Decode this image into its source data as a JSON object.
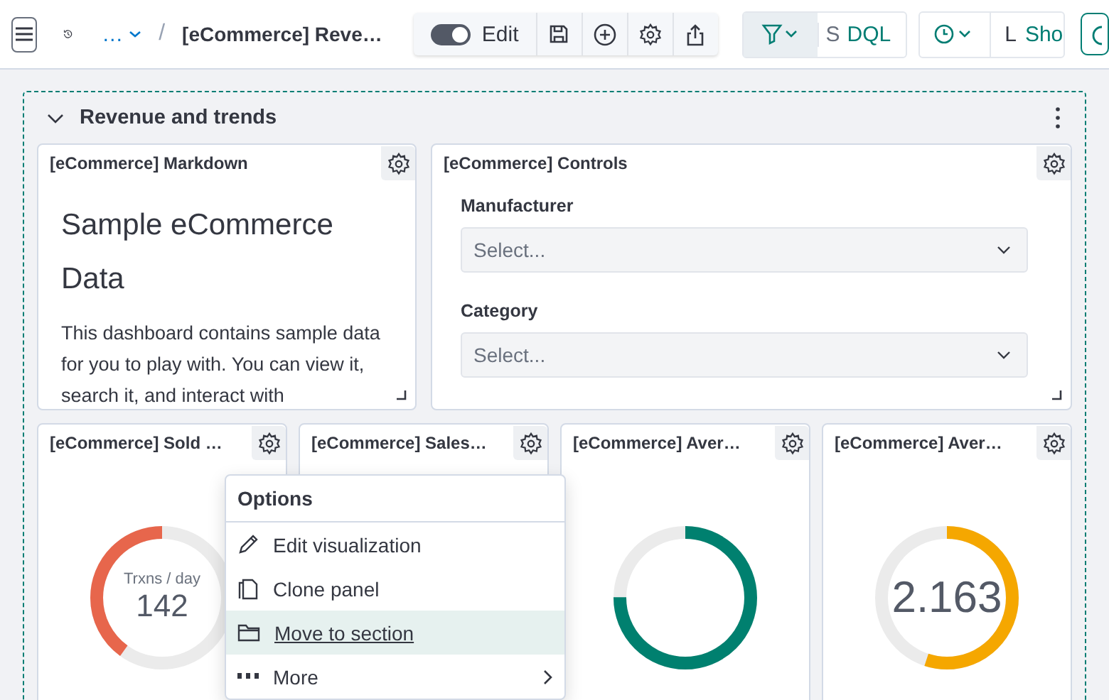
{
  "top_bar": {
    "breadcrumb_more": "…",
    "separator": "/",
    "title": "[eCommerce] Reve…",
    "edit_toggle": {
      "label": "Edit",
      "on": true
    },
    "query": {
      "placeholder": "S",
      "language": "DQL"
    },
    "time": {
      "text": "L",
      "show_dates": "Sho"
    }
  },
  "section": {
    "title": "Revenue and trends",
    "expanded": true
  },
  "markdown_panel": {
    "title": "[eCommerce] Markdown",
    "heading": "Sample eCommerce Data",
    "body": "This dashboard contains sample data for you to play with. You can view it, search it, and interact with"
  },
  "controls_panel": {
    "title": "[eCommerce] Controls",
    "controls": [
      {
        "label": "Manufacturer",
        "placeholder": "Select..."
      },
      {
        "label": "Category",
        "placeholder": "Select..."
      }
    ]
  },
  "gauge_panels": [
    {
      "title": "[eCommerce] Sold …",
      "color": "#e7664c",
      "level": 0.4,
      "label": "Trxns / day",
      "value": "142"
    },
    {
      "title": "[eCommerce] Sales…"
    },
    {
      "title": "[eCommerce] Aver…",
      "color": "#00806f",
      "level": 0.75
    },
    {
      "title": "[eCommerce] Aver…",
      "color": "#f5a700",
      "level": 0.55,
      "value": "2.163"
    }
  ],
  "options_menu": {
    "title": "Options",
    "items": [
      {
        "kind": "pencil",
        "label": "Edit visualization",
        "selected": false
      },
      {
        "kind": "copy",
        "label": "Clone panel",
        "selected": false
      },
      {
        "kind": "folder",
        "label": "Move to section",
        "selected": true
      },
      {
        "kind": "grid",
        "label": "More",
        "selected": false,
        "submenu": true
      }
    ]
  }
}
